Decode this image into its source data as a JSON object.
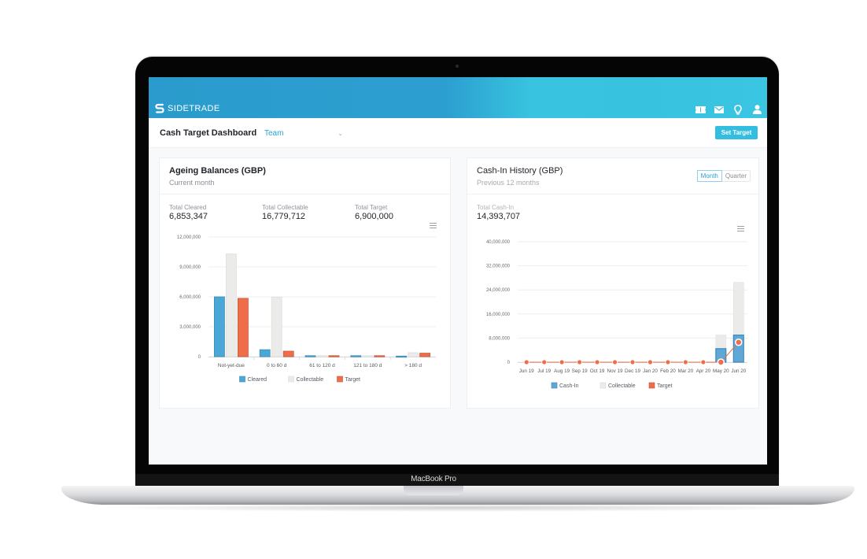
{
  "device": {
    "label": "MacBook Pro"
  },
  "app": {
    "logo_text": "SIDETRADE",
    "brand_colors": {
      "topbar_start": "#2a9bcc",
      "topbar_end": "#3ac6e2",
      "accent": "#33bde0"
    },
    "nav_icons": [
      {
        "name": "ticket-icon"
      },
      {
        "name": "mail-icon"
      },
      {
        "name": "lightbulb-icon"
      },
      {
        "name": "user-icon"
      }
    ]
  },
  "subheader": {
    "title": "Cash Target Dashboard",
    "team_select": {
      "value": "Team"
    },
    "set_target_label": "Set Target"
  },
  "ageing": {
    "title": "Ageing Balances (GBP)",
    "subtitle": "Current month",
    "stats": [
      {
        "label": "Total Cleared",
        "value": "6,853,347"
      },
      {
        "label": "Total Collectable",
        "value": "16,779,712"
      },
      {
        "label": "Total Target",
        "value": "6,900,000"
      }
    ]
  },
  "cashin": {
    "title": "Cash-In History (GBP)",
    "subtitle": "Previous 12 months",
    "toggle": [
      {
        "label": "Month",
        "active": true
      },
      {
        "label": "Quarter",
        "active": false
      }
    ],
    "stats": [
      {
        "label": "Total Cash-In",
        "value": "14,393,707"
      }
    ]
  },
  "chart_data": [
    {
      "type": "bar",
      "title": "Ageing Balances (GBP)",
      "categories": [
        "Not-yet-due",
        "0 to 60 d",
        "61 to 120 d",
        "121 to 180 d",
        "> 180 d"
      ],
      "series": [
        {
          "name": "Cleared",
          "color": "#4aa8d8",
          "values": [
            6000000,
            700000,
            100000,
            100000,
            60000
          ]
        },
        {
          "name": "Collectable",
          "color": "#ebebea",
          "values": [
            10300000,
            5950000,
            100000,
            100000,
            400000
          ]
        },
        {
          "name": "Target",
          "color": "#ef6d49",
          "values": [
            5850000,
            550000,
            100000,
            100000,
            350000
          ]
        }
      ],
      "ylim": [
        0,
        12000000
      ],
      "yticks": [
        "0",
        "3,000,000",
        "6,000,000",
        "9,000,000",
        "12,000,000"
      ],
      "ytick_values": [
        0,
        3000000,
        6000000,
        9000000,
        12000000
      ],
      "grid": true,
      "legend": "bottom",
      "xlabel": "",
      "ylabel": ""
    },
    {
      "type": "bar",
      "title": "Cash-In History (GBP)",
      "categories": [
        "Jun 19",
        "Jul 19",
        "Aug 19",
        "Sep 19",
        "Oct 19",
        "Nov 19",
        "Dec 19",
        "Jan 20",
        "Feb 20",
        "Mar 20",
        "Apr 20",
        "May 20",
        "Jun 20"
      ],
      "series": [
        {
          "name": "Cash-In",
          "color": "#5fa8d6",
          "kind": "bar",
          "values": [
            0,
            0,
            0,
            0,
            0,
            0,
            0,
            0,
            0,
            0,
            0,
            4500000,
            9000000
          ]
        },
        {
          "name": "Collectable",
          "color": "#ebebea",
          "kind": "bar",
          "values": [
            0,
            0,
            0,
            0,
            0,
            0,
            0,
            0,
            0,
            0,
            0,
            9000000,
            26500000
          ]
        },
        {
          "name": "Target",
          "color": "#ef6d49",
          "kind": "line",
          "values": [
            0,
            0,
            0,
            0,
            0,
            0,
            0,
            0,
            0,
            0,
            0,
            0,
            6600000
          ]
        }
      ],
      "ylim": [
        0,
        40000000
      ],
      "yticks": [
        "0",
        "8,000,000",
        "16,000,000",
        "24,000,000",
        "32,000,000",
        "40,000,000"
      ],
      "ytick_values": [
        0,
        8000000,
        16000000,
        24000000,
        32000000,
        40000000
      ],
      "grid": true,
      "legend": "bottom",
      "xlabel": "",
      "ylabel": ""
    }
  ]
}
